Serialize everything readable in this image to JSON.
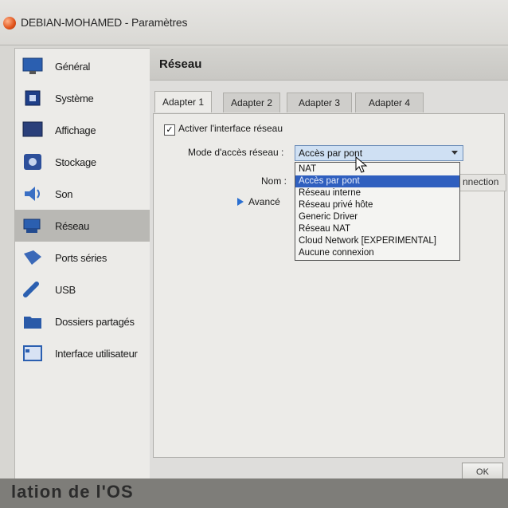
{
  "window": {
    "title": "DEBIAN-MOHAMED - Paramètres"
  },
  "sidebar": {
    "items": [
      {
        "label": "Général",
        "icon": "monitor-icon"
      },
      {
        "label": "Système",
        "icon": "chip-icon"
      },
      {
        "label": "Affichage",
        "icon": "display-icon"
      },
      {
        "label": "Stockage",
        "icon": "disk-icon"
      },
      {
        "label": "Son",
        "icon": "speaker-icon"
      },
      {
        "label": "Réseau",
        "icon": "network-icon",
        "selected": true
      },
      {
        "label": "Ports séries",
        "icon": "serial-port-icon"
      },
      {
        "label": "USB",
        "icon": "usb-icon"
      },
      {
        "label": "Dossiers partagés",
        "icon": "folder-icon"
      },
      {
        "label": "Interface utilisateur",
        "icon": "ui-window-icon"
      }
    ]
  },
  "section": {
    "title": "Réseau"
  },
  "tabs": [
    "Adapter 1",
    "Adapter 2",
    "Adapter 3",
    "Adapter 4"
  ],
  "adapter": {
    "enable_label": "Activer l'interface réseau",
    "enabled": true,
    "mode_label": "Mode d'accès réseau :",
    "mode_value": "Accès par pont",
    "name_label": "Nom :",
    "name_partial": "nnection",
    "advanced_label": "Avancé"
  },
  "dropdown": {
    "options": [
      "NAT",
      "Accès par pont",
      "Réseau interne",
      "Réseau privé hôte",
      "Generic Driver",
      "Réseau NAT",
      "Cloud Network [EXPERIMENTAL]",
      "Aucune connexion"
    ],
    "highlighted_index": 1
  },
  "buttons": {
    "ok": "OK"
  },
  "bottom_text": "lation de l'OS"
}
